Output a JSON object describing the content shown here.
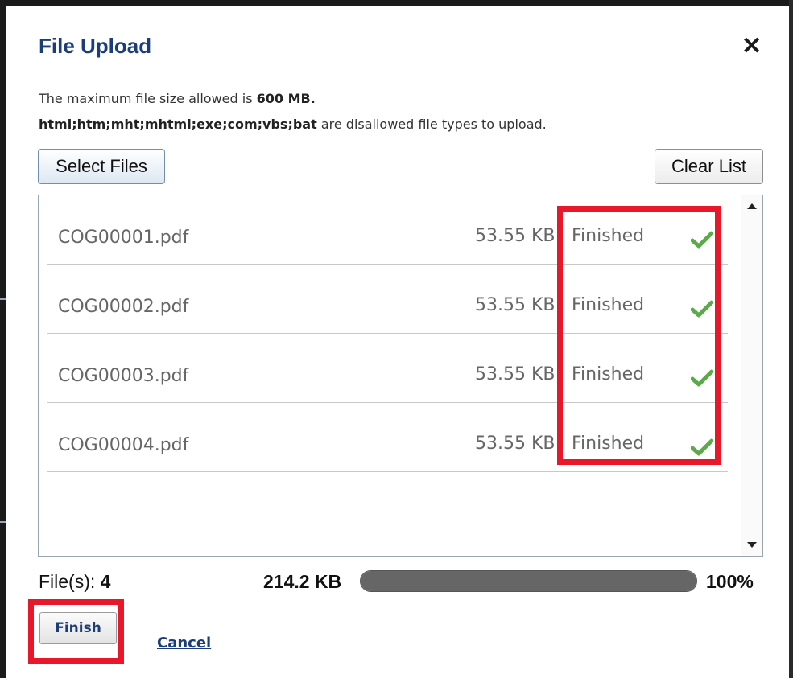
{
  "dialog": {
    "title": "File Upload",
    "close_glyph": "✕"
  },
  "info": {
    "max_size_text": "The maximum file size allowed is ",
    "max_size_value": "600 MB.",
    "disallowed_types": "html;htm;mht;mhtml;exe;com;vbs;bat",
    "disallowed_suffix": " are disallowed file types to upload."
  },
  "toolbar": {
    "select_files_label": "Select Files",
    "clear_list_label": "Clear List"
  },
  "files": [
    {
      "name": "COG00001.pdf",
      "size": "53.55 KB",
      "status": "Finished"
    },
    {
      "name": "COG00002.pdf",
      "size": "53.55 KB",
      "status": "Finished"
    },
    {
      "name": "COG00003.pdf",
      "size": "53.55 KB",
      "status": "Finished"
    },
    {
      "name": "COG00004.pdf",
      "size": "53.55 KB",
      "status": "Finished"
    }
  ],
  "footer": {
    "files_label": "File(s):",
    "files_count": "4",
    "total_size": "214.2 KB",
    "progress_percent": "100%",
    "progress_value": 100
  },
  "actions": {
    "finish_label": "Finish",
    "cancel_label": "Cancel"
  },
  "colors": {
    "title": "#1b3d7a",
    "highlight": "#e8182a",
    "check": "#5aaa4a",
    "progress_fill": "#666666"
  },
  "icons": [
    "close-icon",
    "checkmark-icon",
    "scroll-up-arrow-icon",
    "scroll-down-arrow-icon"
  ]
}
